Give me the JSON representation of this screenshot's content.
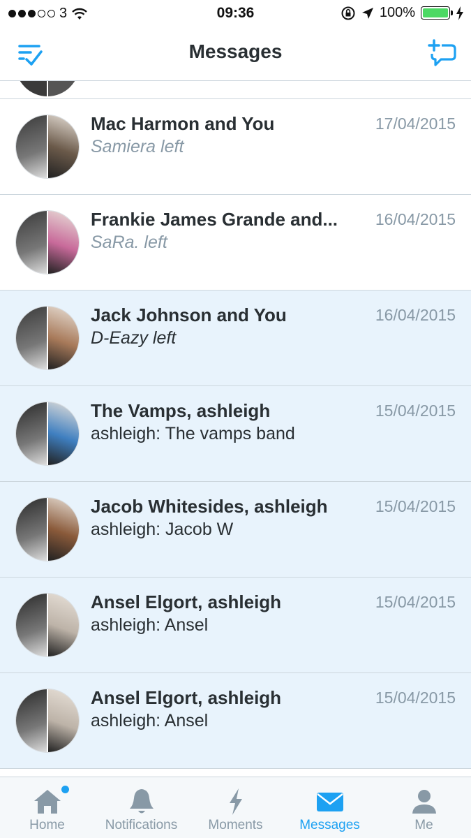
{
  "status_bar": {
    "carrier": "3",
    "time": "09:36",
    "battery": "100%"
  },
  "nav": {
    "title": "Messages"
  },
  "conversations": [
    {
      "title": "Mac Harmon and You",
      "subtitle": "Samiera left",
      "date": "17/04/2015",
      "read": true,
      "system": true,
      "avatar_colors": [
        "#3a3a3a",
        "#6b5a4a"
      ]
    },
    {
      "title": "Frankie James Grande and...",
      "subtitle": "SaRa. left",
      "date": "16/04/2015",
      "read": true,
      "system": true,
      "avatar_colors": [
        "#3a3a3a",
        "#c86a9a"
      ]
    },
    {
      "title": "Jack Johnson and You",
      "subtitle": "D-Eazy left",
      "date": "16/04/2015",
      "read": false,
      "system": true,
      "avatar_colors": [
        "#3a3a3a",
        "#a87a5a"
      ]
    },
    {
      "title": "The Vamps, ashleigh",
      "subtitle": "ashleigh: The vamps band",
      "date": "15/04/2015",
      "read": false,
      "system": false,
      "avatar_colors": [
        "#2a2a2a",
        "#3f7fc0"
      ]
    },
    {
      "title": "Jacob Whitesides, ashleigh",
      "subtitle": "ashleigh: Jacob W",
      "date": "15/04/2015",
      "read": false,
      "system": false,
      "avatar_colors": [
        "#2a2a2a",
        "#8a5a3a"
      ]
    },
    {
      "title": "Ansel Elgort, ashleigh",
      "subtitle": "ashleigh: Ansel",
      "date": "15/04/2015",
      "read": false,
      "system": false,
      "avatar_colors": [
        "#2a2a2a",
        "#bdb3a8"
      ]
    },
    {
      "title": "Ansel Elgort, ashleigh",
      "subtitle": "ashleigh: Ansel",
      "date": "15/04/2015",
      "read": false,
      "system": false,
      "avatar_colors": [
        "#2a2a2a",
        "#bdb3a8"
      ]
    }
  ],
  "tabs": [
    {
      "label": "Home",
      "icon": "home-icon",
      "active": false,
      "badge": true
    },
    {
      "label": "Notifications",
      "icon": "bell-icon",
      "active": false,
      "badge": false
    },
    {
      "label": "Moments",
      "icon": "lightning-icon",
      "active": false,
      "badge": false
    },
    {
      "label": "Messages",
      "icon": "envelope-icon",
      "active": true,
      "badge": false
    },
    {
      "label": "Me",
      "icon": "person-icon",
      "active": false,
      "badge": false
    }
  ],
  "colors": {
    "accent": "#1da1f2",
    "unread_bg": "#e8f3fc",
    "muted": "#8899a6",
    "text": "#292f33"
  }
}
